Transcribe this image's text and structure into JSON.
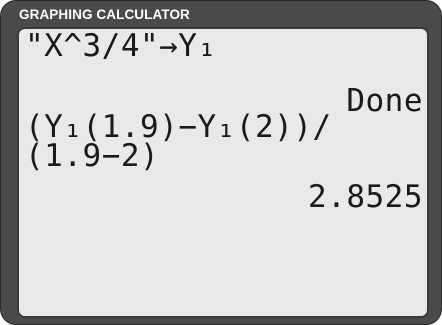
{
  "device": {
    "label": "GRAPHING CALCULATOR"
  },
  "screen": {
    "lines": [
      {
        "text": "\"X^3/4\"→Y₁",
        "align": "left"
      },
      {
        "text": "Done",
        "align": "right"
      },
      {
        "text": "(Y₁(1.9)−Y₁(2))/",
        "align": "left"
      },
      {
        "text": "(1.9−2)",
        "align": "left"
      },
      {
        "text": "2.8525",
        "align": "right"
      }
    ]
  }
}
